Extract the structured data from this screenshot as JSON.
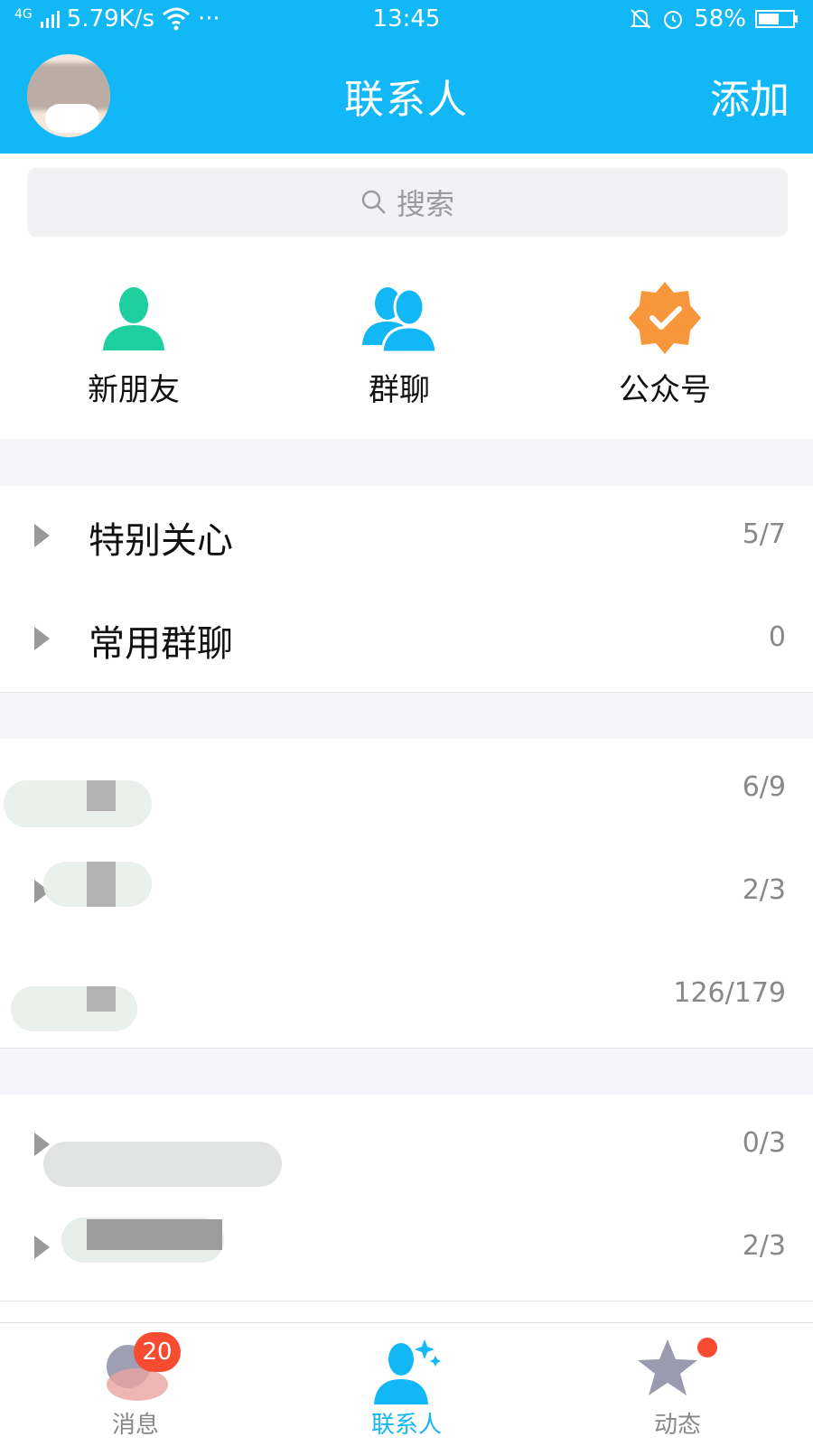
{
  "status_bar": {
    "network": "4G",
    "speed": "5.79K/s",
    "more": "···",
    "time": "13:45",
    "battery": "58%"
  },
  "nav": {
    "title": "联系人",
    "action": "添加"
  },
  "search": {
    "placeholder": "搜索"
  },
  "quick_entries": [
    {
      "label": "新朋友",
      "icon": "new-friend-icon",
      "color": "#1ecf9f"
    },
    {
      "label": "群聊",
      "icon": "group-chat-icon",
      "color": "#12b7f5"
    },
    {
      "label": "公众号",
      "icon": "official-account-icon",
      "color": "#f7963b"
    }
  ],
  "groups": [
    {
      "name": "特别关心",
      "count": "5/7"
    },
    {
      "name": "常用群聊",
      "count": "0"
    },
    {
      "name": "",
      "count": "6/9"
    },
    {
      "name": "",
      "count": "2/3"
    },
    {
      "name": "",
      "count": "126/179"
    },
    {
      "name": "",
      "count": "0/3"
    },
    {
      "name": "",
      "count": "2/3"
    }
  ],
  "tabs": [
    {
      "label": "消息",
      "badge": "20"
    },
    {
      "label": "联系人"
    },
    {
      "label": "动态"
    }
  ],
  "colors": {
    "brand": "#12b7f5",
    "badge": "#f74c31"
  }
}
